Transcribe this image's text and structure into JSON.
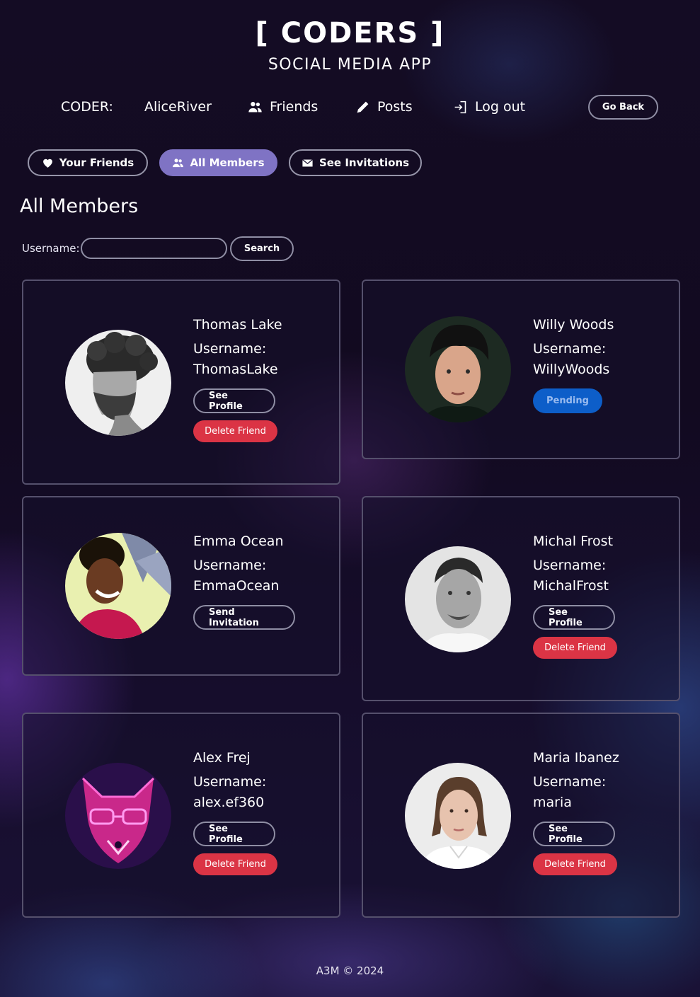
{
  "app": {
    "title": "[ CODERS ]",
    "subtitle": "SOCIAL MEDIA APP"
  },
  "nav": {
    "coder_label": "CODER:",
    "username": "AliceRiver",
    "friends": "Friends",
    "posts": "Posts",
    "logout": "Log out",
    "go_back": "Go Back"
  },
  "filters": {
    "your_friends": "Your Friends",
    "all_members": "All Members",
    "see_invitations": "See Invitations",
    "active": "All Members"
  },
  "section_title": "All Members",
  "search": {
    "label": "Username:",
    "value": "",
    "button": "Search"
  },
  "members": [
    {
      "name": "Thomas Lake",
      "username_label": "Username:",
      "username": "ThomasLake",
      "primary": "See Profile",
      "secondary": "Delete Friend"
    },
    {
      "name": "Willy Woods",
      "username_label": "Username:",
      "username": "WillyWoods",
      "primary": "Pending"
    },
    {
      "name": "Emma Ocean",
      "username_label": "Username:",
      "username": "EmmaOcean",
      "primary": "Send Invitation"
    },
    {
      "name": "Michal Frost",
      "username_label": "Username:",
      "username": "MichalFrost",
      "primary": "See Profile",
      "secondary": "Delete Friend"
    },
    {
      "name": "Alex Frej",
      "username_label": "Username:",
      "username": "alex.ef360",
      "primary": "See Profile",
      "secondary": "Delete Friend"
    },
    {
      "name": "Maria Ibanez",
      "username_label": "Username:",
      "username": "maria",
      "primary": "See Profile",
      "secondary": "Delete Friend"
    }
  ],
  "footer": "A3M © 2024",
  "colors": {
    "accent": "#7f73c4",
    "danger": "#db3445",
    "pending": "#0d5ec9",
    "card_border": "#55506c"
  }
}
